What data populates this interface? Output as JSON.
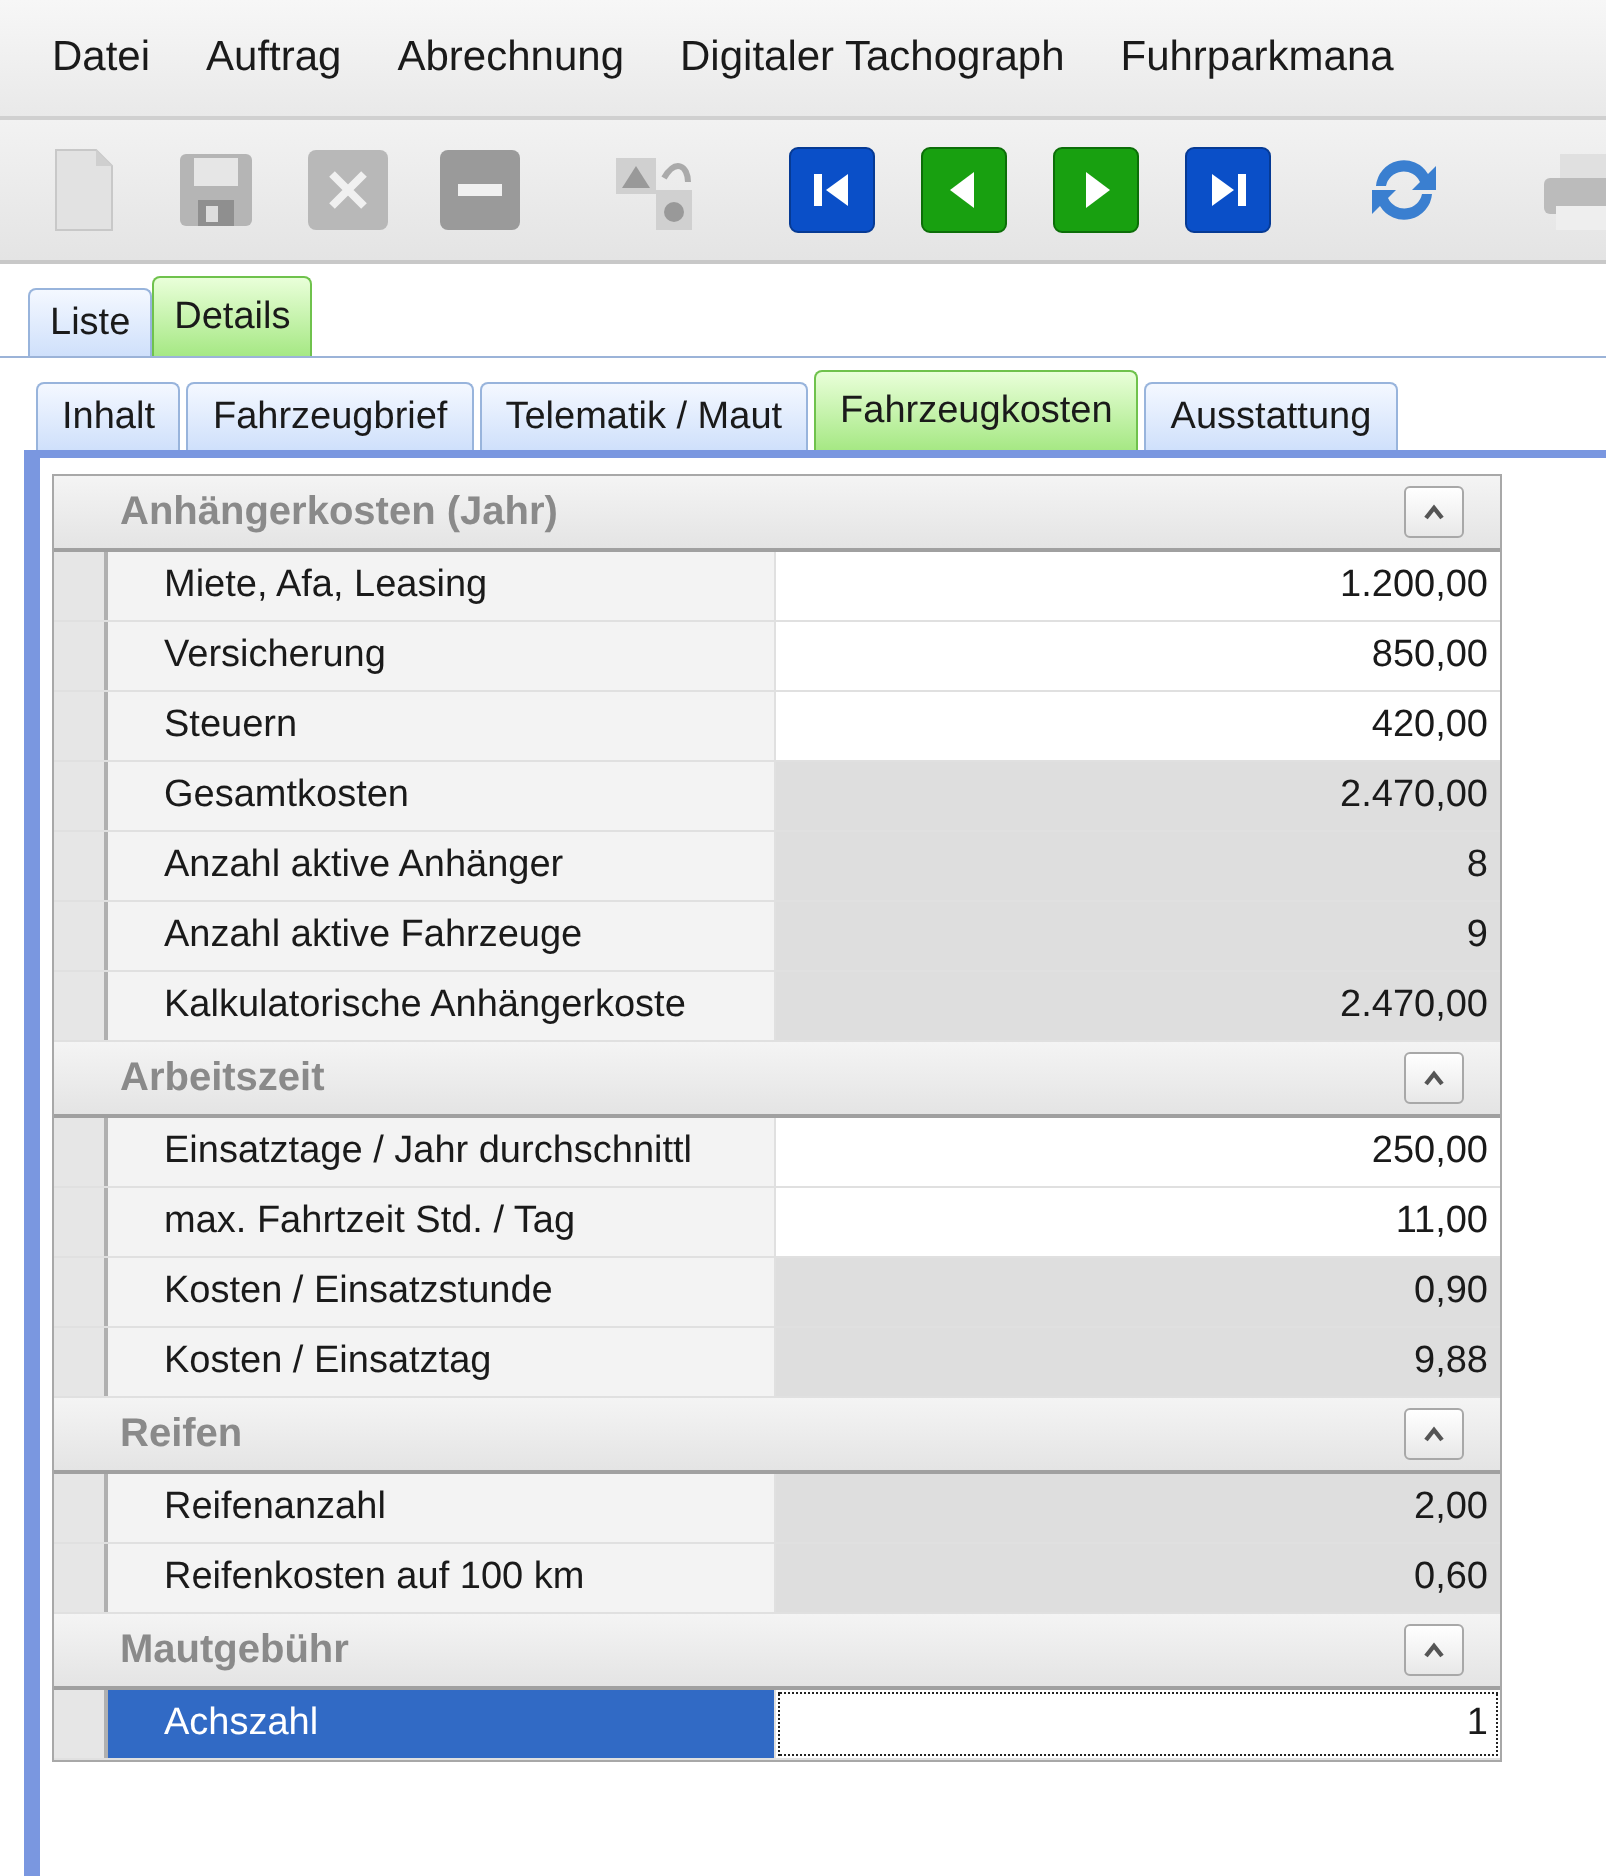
{
  "menu": [
    "Datei",
    "Auftrag",
    "Abrechnung",
    "Digitaler Tachograph",
    "Fuhrparkmana"
  ],
  "toolbar": [
    {
      "kind": "new",
      "disabled": true
    },
    {
      "kind": "save",
      "disabled": true
    },
    {
      "kind": "delete",
      "disabled": true
    },
    {
      "kind": "remove",
      "disabled": true
    },
    {
      "kind": "sep"
    },
    {
      "kind": "copy",
      "disabled": true
    },
    {
      "kind": "sep"
    },
    {
      "kind": "first",
      "disabled": false
    },
    {
      "kind": "prev",
      "disabled": false
    },
    {
      "kind": "next",
      "disabled": false
    },
    {
      "kind": "last",
      "disabled": false
    },
    {
      "kind": "sep"
    },
    {
      "kind": "refresh",
      "disabled": false
    },
    {
      "kind": "sep"
    },
    {
      "kind": "print",
      "disabled": true
    }
  ],
  "view_tabs": [
    {
      "label": "Liste",
      "selected": false
    },
    {
      "label": "Details",
      "selected": true
    }
  ],
  "detail_tabs": [
    {
      "label": "Inhalt",
      "selected": false
    },
    {
      "label": "Fahrzeugbrief",
      "selected": false
    },
    {
      "label": "Telematik / Maut",
      "selected": false
    },
    {
      "label": "Fahrzeugkosten",
      "selected": true
    },
    {
      "label": "Ausstattung",
      "selected": false
    }
  ],
  "sections": [
    {
      "title": "Anhängerkosten (Jahr)",
      "expanded": true,
      "rows": [
        {
          "label": "Miete, Afa, Leasing",
          "value": "1.200,00",
          "editable": true,
          "selected": false
        },
        {
          "label": "Versicherung",
          "value": "850,00",
          "editable": true,
          "selected": false
        },
        {
          "label": "Steuern",
          "value": "420,00",
          "editable": true,
          "selected": false
        },
        {
          "label": "Gesamtkosten",
          "value": "2.470,00",
          "editable": false,
          "selected": false
        },
        {
          "label": "Anzahl aktive Anhänger",
          "value": "8",
          "editable": false,
          "selected": false
        },
        {
          "label": "Anzahl aktive Fahrzeuge",
          "value": "9",
          "editable": false,
          "selected": false
        },
        {
          "label": "Kalkulatorische Anhängerkoste",
          "value": "2.470,00",
          "editable": false,
          "selected": false
        }
      ]
    },
    {
      "title": "Arbeitszeit",
      "expanded": true,
      "rows": [
        {
          "label": "Einsatztage / Jahr durchschnittl",
          "value": "250,00",
          "editable": true,
          "selected": false
        },
        {
          "label": "max. Fahrtzeit Std. / Tag",
          "value": "11,00",
          "editable": true,
          "selected": false
        },
        {
          "label": "Kosten / Einsatzstunde",
          "value": "0,90",
          "editable": false,
          "selected": false
        },
        {
          "label": "Kosten / Einsatztag",
          "value": "9,88",
          "editable": false,
          "selected": false
        }
      ]
    },
    {
      "title": "Reifen",
      "expanded": true,
      "rows": [
        {
          "label": "Reifenanzahl",
          "value": "2,00",
          "editable": false,
          "selected": false
        },
        {
          "label": "Reifenkosten auf 100 km",
          "value": "0,60",
          "editable": false,
          "selected": false
        }
      ]
    },
    {
      "title": "Mautgebühr",
      "expanded": true,
      "rows": [
        {
          "label": "Achszahl",
          "value": "1",
          "editable": true,
          "selected": true
        }
      ]
    }
  ]
}
